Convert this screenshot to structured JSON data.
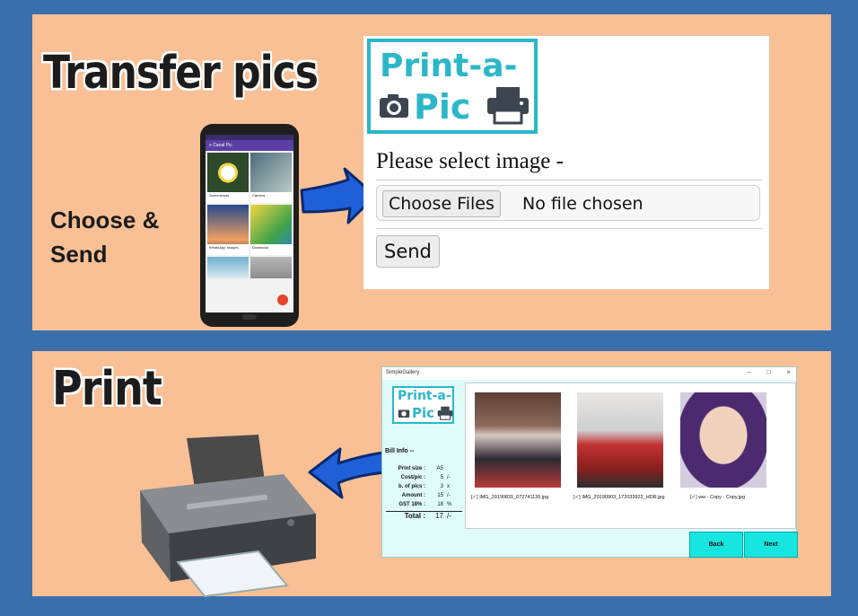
{
  "top_panel": {
    "title": "Transfer pics",
    "side_label_line1": "Choose &",
    "side_label_line2": "Send",
    "phone": {
      "app_title": "Canal Pic",
      "status_time": "11:56 am",
      "tiles": [
        {
          "name": "Screenshots",
          "count": "31 photos"
        },
        {
          "name": "Camera",
          "count": "78 photos"
        },
        {
          "name": "WhatsApp Images",
          "count": "84 photos"
        },
        {
          "name": "Download",
          "count": "8 photos"
        }
      ]
    },
    "form": {
      "logo_line1": "Print-a-",
      "logo_line2": "Pic",
      "prompt": "Please select image -",
      "choose_files_label": "Choose Files",
      "no_file_text": "No file chosen",
      "send_label": "Send"
    }
  },
  "bottom_panel": {
    "title": "Print",
    "gallery": {
      "window_title": "SimpleGallery",
      "logo_line1": "Print-a-",
      "logo_line2": "Pic",
      "bill_title": "Bill Info --",
      "bill_rows": [
        {
          "label": "Print size :",
          "value": "A5",
          "unit": ""
        },
        {
          "label": "Cost/pic :",
          "value": "5",
          "unit": "/-"
        },
        {
          "label": "b. of pics :",
          "value": "3",
          "unit": "x"
        },
        {
          "label": "Amount :",
          "value": "15",
          "unit": "/-"
        },
        {
          "label": "GST 18% :",
          "value": "18",
          "unit": "%"
        }
      ],
      "total_label": "Total :",
      "total_value": "17",
      "total_unit": "/-",
      "photos": [
        {
          "caption": "[✓] IMG_20190831_072741136.jpg"
        },
        {
          "caption": "[✓] IMG_20190903_172033922_HDR.jpg"
        },
        {
          "caption": "[✓] ww - Copy - Copy.jpg"
        }
      ],
      "back_label": "Back",
      "next_label": "Next"
    }
  },
  "colors": {
    "background": "#3a6fae",
    "panel": "#f9c095",
    "accent": "#2cb7c9",
    "arrow": "#1f5fd8",
    "button_cyan": "#17e6e0"
  }
}
